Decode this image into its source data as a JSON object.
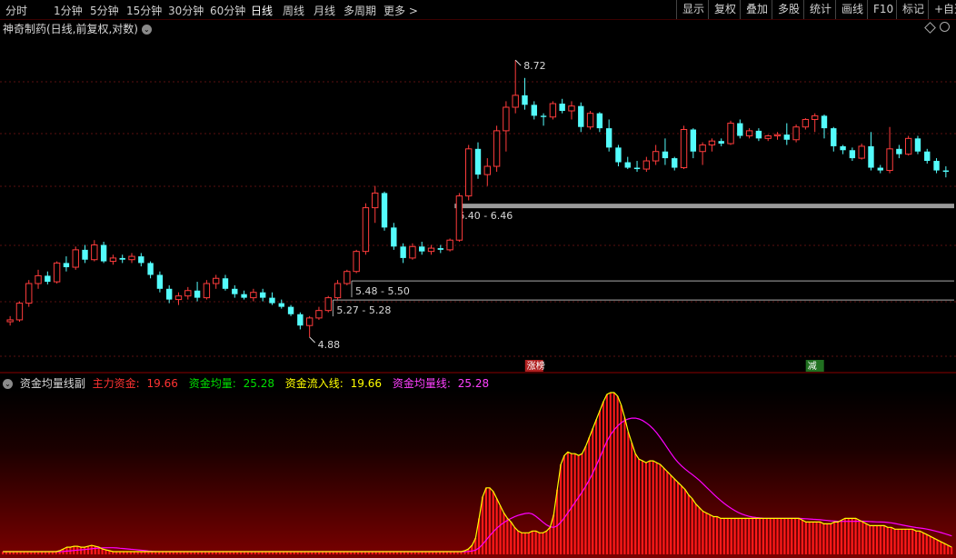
{
  "toolbar": {
    "periods": [
      "分时",
      "1分钟",
      "5分钟",
      "15分钟",
      "30分钟",
      "60分钟",
      "日线",
      "周线",
      "月线",
      "多周期",
      "更多 >"
    ],
    "active_index": 6,
    "buttons": [
      "显示",
      "复权",
      "叠加",
      "多股",
      "统计",
      "画线",
      "F10",
      "标记",
      "+自选"
    ]
  },
  "main_title": "神奇制药(日线,前复权,对数)",
  "sub_title": "资金均量线副",
  "legend": {
    "main_funds_label": "主力资金:",
    "main_funds_value": "19.66",
    "avg_volume_label": "资金均量:",
    "avg_volume_value": "25.28",
    "inflow_line_label": "资金流入线:",
    "inflow_line_value": "19.66",
    "avg_line_label": "资金均量线:",
    "avg_line_value": "25.28"
  },
  "colors": {
    "up": "#ff3c3c",
    "down": "#54fcfc",
    "main_funds": "#ff3232",
    "avg_volume": "#00e000",
    "inflow_line": "#ffff00",
    "avg_line": "#ff00ff",
    "bar": "#ff1a1a"
  },
  "annotations": {
    "high": "8.72",
    "low": "4.88",
    "zone1": "6.40 - 6.46",
    "zone2": "5.48 - 5.50",
    "zone3": "5.27 - 5.28",
    "tag1": "涨榜",
    "tag2": "减"
  },
  "chart_data": {
    "type": "candlestick",
    "title": "神奇制药(日线,前复权,对数)",
    "log_scale": true,
    "price_range": [
      4.6,
      9.2
    ],
    "candles": [
      [
        5.04,
        5.1,
        5.0,
        5.06
      ],
      [
        5.06,
        5.26,
        5.04,
        5.24
      ],
      [
        5.24,
        5.5,
        5.2,
        5.46
      ],
      [
        5.46,
        5.62,
        5.4,
        5.55
      ],
      [
        5.55,
        5.6,
        5.45,
        5.48
      ],
      [
        5.48,
        5.72,
        5.46,
        5.7
      ],
      [
        5.7,
        5.78,
        5.6,
        5.65
      ],
      [
        5.65,
        5.9,
        5.62,
        5.86
      ],
      [
        5.86,
        5.92,
        5.7,
        5.74
      ],
      [
        5.74,
        5.98,
        5.72,
        5.92
      ],
      [
        5.92,
        5.96,
        5.7,
        5.72
      ],
      [
        5.72,
        5.8,
        5.68,
        5.76
      ],
      [
        5.76,
        5.8,
        5.7,
        5.74
      ],
      [
        5.74,
        5.82,
        5.7,
        5.78
      ],
      [
        5.78,
        5.82,
        5.66,
        5.7
      ],
      [
        5.7,
        5.72,
        5.52,
        5.56
      ],
      [
        5.56,
        5.6,
        5.36,
        5.4
      ],
      [
        5.4,
        5.44,
        5.24,
        5.28
      ],
      [
        5.28,
        5.36,
        5.22,
        5.32
      ],
      [
        5.32,
        5.42,
        5.28,
        5.38
      ],
      [
        5.38,
        5.48,
        5.26,
        5.3
      ],
      [
        5.3,
        5.5,
        5.28,
        5.46
      ],
      [
        5.46,
        5.56,
        5.4,
        5.52
      ],
      [
        5.52,
        5.56,
        5.38,
        5.4
      ],
      [
        5.4,
        5.44,
        5.3,
        5.34
      ],
      [
        5.34,
        5.38,
        5.28,
        5.3
      ],
      [
        5.3,
        5.4,
        5.26,
        5.36
      ],
      [
        5.36,
        5.4,
        5.26,
        5.3
      ],
      [
        5.3,
        5.36,
        5.22,
        5.24
      ],
      [
        5.24,
        5.28,
        5.18,
        5.2
      ],
      [
        5.2,
        5.22,
        5.1,
        5.12
      ],
      [
        5.12,
        5.14,
        4.96,
        5.0
      ],
      [
        5.0,
        5.1,
        4.88,
        5.08
      ],
      [
        5.08,
        5.2,
        5.06,
        5.16
      ],
      [
        5.16,
        5.32,
        5.14,
        5.3
      ],
      [
        5.3,
        5.5,
        5.28,
        5.46
      ],
      [
        5.46,
        5.62,
        5.44,
        5.6
      ],
      [
        5.6,
        5.86,
        5.58,
        5.84
      ],
      [
        5.84,
        6.46,
        5.8,
        6.4
      ],
      [
        6.4,
        6.7,
        6.2,
        6.6
      ],
      [
        6.6,
        6.62,
        6.1,
        6.14
      ],
      [
        6.14,
        6.2,
        5.86,
        5.9
      ],
      [
        5.9,
        5.94,
        5.7,
        5.76
      ],
      [
        5.76,
        5.94,
        5.74,
        5.9
      ],
      [
        5.9,
        5.96,
        5.8,
        5.84
      ],
      [
        5.84,
        5.92,
        5.8,
        5.88
      ],
      [
        5.88,
        5.92,
        5.82,
        5.86
      ],
      [
        5.86,
        6.0,
        5.84,
        5.98
      ],
      [
        5.98,
        6.6,
        5.96,
        6.56
      ],
      [
        6.56,
        7.3,
        6.5,
        7.24
      ],
      [
        7.24,
        7.34,
        6.8,
        6.86
      ],
      [
        6.86,
        7.1,
        6.7,
        6.98
      ],
      [
        6.98,
        7.6,
        6.9,
        7.52
      ],
      [
        7.52,
        8.0,
        7.2,
        7.9
      ],
      [
        7.9,
        8.72,
        7.8,
        8.1
      ],
      [
        8.1,
        8.4,
        7.86,
        7.94
      ],
      [
        7.94,
        8.0,
        7.7,
        7.76
      ],
      [
        7.76,
        7.8,
        7.6,
        7.74
      ],
      [
        7.74,
        8.0,
        7.7,
        7.96
      ],
      [
        7.96,
        8.04,
        7.8,
        7.84
      ],
      [
        7.84,
        8.0,
        7.7,
        7.92
      ],
      [
        7.92,
        7.98,
        7.5,
        7.58
      ],
      [
        7.58,
        7.84,
        7.54,
        7.8
      ],
      [
        7.8,
        7.82,
        7.5,
        7.56
      ],
      [
        7.56,
        7.7,
        7.2,
        7.26
      ],
      [
        7.26,
        7.3,
        6.98,
        7.04
      ],
      [
        7.04,
        7.12,
        6.94,
        6.96
      ],
      [
        6.96,
        7.06,
        6.9,
        6.94
      ],
      [
        6.94,
        7.12,
        6.9,
        7.06
      ],
      [
        7.06,
        7.3,
        7.0,
        7.2
      ],
      [
        7.2,
        7.4,
        7.0,
        7.1
      ],
      [
        7.1,
        7.12,
        6.92,
        6.96
      ],
      [
        6.96,
        7.6,
        6.94,
        7.54
      ],
      [
        7.54,
        7.56,
        7.1,
        7.2
      ],
      [
        7.2,
        7.34,
        7.0,
        7.3
      ],
      [
        7.3,
        7.4,
        7.2,
        7.36
      ],
      [
        7.36,
        7.4,
        7.28,
        7.32
      ],
      [
        7.32,
        7.68,
        7.3,
        7.64
      ],
      [
        7.64,
        7.7,
        7.4,
        7.44
      ],
      [
        7.44,
        7.56,
        7.4,
        7.52
      ],
      [
        7.52,
        7.56,
        7.36,
        7.4
      ],
      [
        7.4,
        7.46,
        7.36,
        7.44
      ],
      [
        7.44,
        7.5,
        7.38,
        7.46
      ],
      [
        7.46,
        7.64,
        7.3,
        7.38
      ],
      [
        7.38,
        7.62,
        7.34,
        7.58
      ],
      [
        7.58,
        7.72,
        7.54,
        7.7
      ],
      [
        7.7,
        7.8,
        7.5,
        7.76
      ],
      [
        7.76,
        7.78,
        7.4,
        7.56
      ],
      [
        7.56,
        7.58,
        7.2,
        7.28
      ],
      [
        7.28,
        7.3,
        7.16,
        7.22
      ],
      [
        7.22,
        7.26,
        7.06,
        7.1
      ],
      [
        7.1,
        7.32,
        7.08,
        7.28
      ],
      [
        7.28,
        7.5,
        6.92,
        6.96
      ],
      [
        6.96,
        7.0,
        6.88,
        6.92
      ],
      [
        6.92,
        7.58,
        6.88,
        7.24
      ],
      [
        7.24,
        7.3,
        7.1,
        7.16
      ],
      [
        7.16,
        7.44,
        7.14,
        7.4
      ],
      [
        7.4,
        7.44,
        7.16,
        7.2
      ],
      [
        7.2,
        7.24,
        7.02,
        7.06
      ],
      [
        7.06,
        7.1,
        6.88,
        6.92
      ],
      [
        6.92,
        6.98,
        6.82,
        6.9
      ]
    ],
    "sub_chart": {
      "bars": [
        3,
        3,
        3,
        3,
        3,
        3,
        3,
        3,
        3,
        3,
        3,
        3,
        3,
        3,
        3,
        3,
        4,
        6,
        8,
        8,
        9,
        9,
        8,
        8,
        9,
        10,
        9,
        8,
        6,
        5,
        4,
        3,
        3,
        3,
        3,
        3,
        3,
        3,
        3,
        3,
        3,
        3,
        3,
        3,
        3,
        3,
        3,
        3,
        3,
        3,
        3,
        3,
        3,
        3,
        3,
        3,
        3,
        3,
        3,
        3,
        3,
        3,
        3,
        3,
        3,
        3,
        3,
        3,
        3,
        3,
        3,
        3,
        3,
        3,
        3,
        3,
        3,
        3,
        3,
        3,
        3,
        3,
        3,
        3,
        3,
        3,
        3,
        3,
        3,
        3,
        3,
        3,
        3,
        3,
        3,
        3,
        3,
        3,
        3,
        3,
        3,
        3,
        3,
        3,
        3,
        3,
        3,
        3,
        3,
        3,
        3,
        3,
        3,
        3,
        3,
        3,
        3,
        3,
        3,
        3,
        3,
        3,
        3,
        3,
        3,
        3,
        3,
        3,
        3,
        3,
        4,
        6,
        10,
        18,
        40,
        64,
        74,
        74,
        70,
        62,
        54,
        46,
        40,
        36,
        30,
        26,
        24,
        24,
        24,
        26,
        26,
        24,
        24,
        26,
        30,
        44,
        72,
        100,
        110,
        114,
        112,
        112,
        110,
        112,
        120,
        130,
        140,
        150,
        160,
        170,
        178,
        180,
        180,
        176,
        166,
        152,
        136,
        124,
        112,
        106,
        104,
        102,
        104,
        104,
        102,
        100,
        96,
        92,
        88,
        84,
        80,
        76,
        72,
        66,
        62,
        56,
        52,
        48,
        46,
        44,
        42,
        42,
        40,
        40,
        40,
        40,
        40,
        40,
        40,
        40,
        40,
        40,
        40,
        40,
        40,
        40,
        40,
        40,
        40,
        40,
        40,
        40,
        40,
        40,
        40,
        38,
        36,
        36,
        36,
        36,
        36,
        34,
        34,
        34,
        36,
        36,
        38,
        40,
        40,
        40,
        40,
        38,
        36,
        34,
        32,
        32,
        32,
        32,
        32,
        30,
        30,
        28,
        28,
        28,
        28,
        28,
        28,
        26,
        26,
        24,
        22,
        20,
        18,
        16,
        14,
        12,
        10,
        8
      ]
    }
  }
}
